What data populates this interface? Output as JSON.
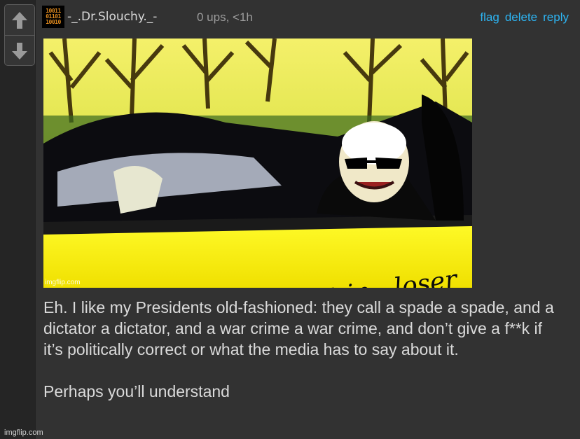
{
  "post": {
    "username": "-_.Dr.Slouchy._-",
    "meta": "0 ups, <1h",
    "actions": {
      "flag": "flag",
      "delete": "delete",
      "reply": "reply"
    },
    "avatar_lines": [
      "10011",
      "01101",
      "10010"
    ]
  },
  "meme": {
    "caption": "Get in , loser",
    "watermark": "imgflip.com"
  },
  "comment": {
    "paragraph1": "Eh. I like my Presidents old-fashioned: they call a spade a spade, and a dictator a dictator, and a war crime a war crime, and don’t give a f**k if it’s politically correct or what the media has to say about it.",
    "paragraph2": "Perhaps you’ll understand"
  },
  "footer": {
    "watermark": "imgflip.com"
  },
  "icons": {
    "upvote": "arrow-up-icon",
    "downvote": "arrow-down-icon"
  },
  "colors": {
    "link": "#2db4f2",
    "avatar_text": "#e08a1e",
    "background": "#323232"
  }
}
